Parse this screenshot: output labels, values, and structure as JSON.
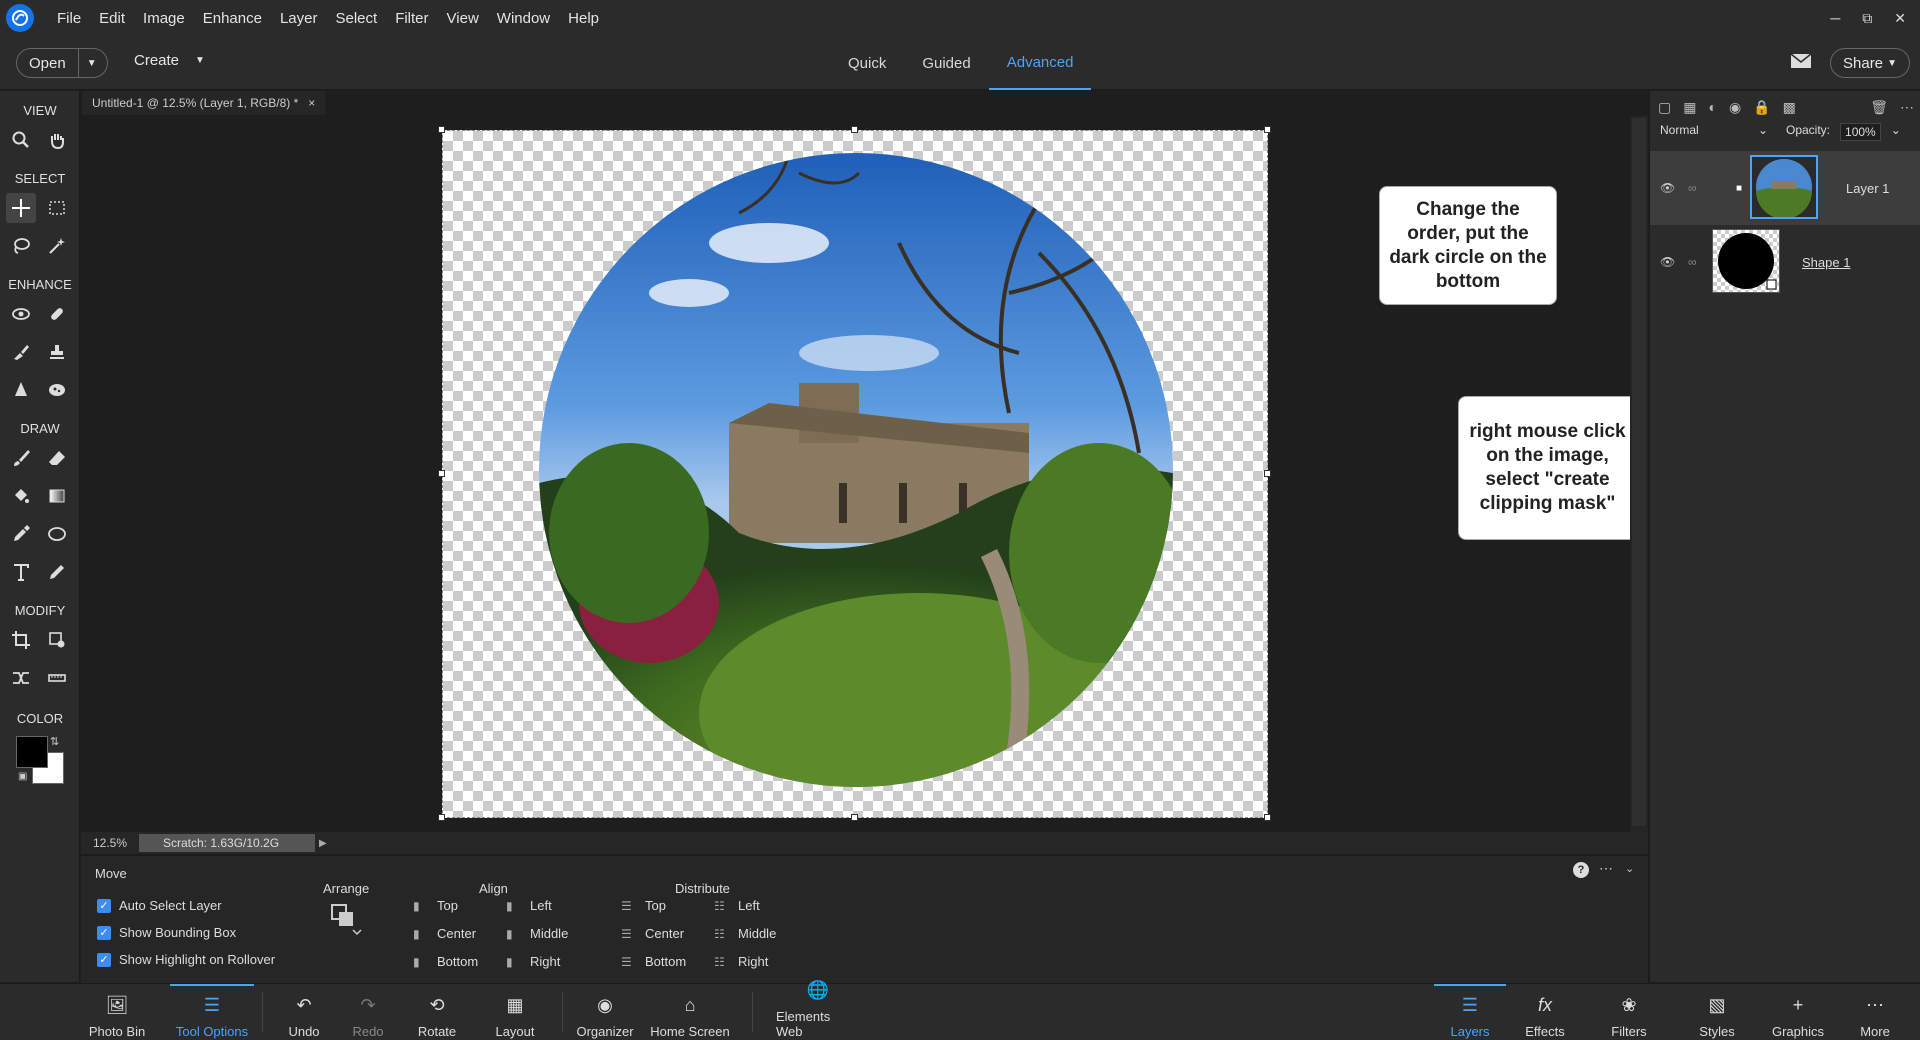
{
  "app": {
    "title": "Adobe Photoshop Elements"
  },
  "menubar": {
    "items": [
      "File",
      "Edit",
      "Image",
      "Enhance",
      "Layer",
      "Select",
      "Filter",
      "View",
      "Window",
      "Help"
    ]
  },
  "topbar": {
    "open_label": "Open",
    "create_label": "Create",
    "modes": [
      "Quick",
      "Guided",
      "Advanced"
    ],
    "active_mode": "Advanced",
    "share_label": "Share"
  },
  "toolbar": {
    "sections": [
      "VIEW",
      "SELECT",
      "ENHANCE",
      "DRAW",
      "MODIFY",
      "COLOR"
    ],
    "foreground_color": "#000000",
    "background_color": "#ffffff"
  },
  "document": {
    "tab_title": "Untitled-1 @ 12.5% (Layer 1, RGB/8) *",
    "close_glyph": "×"
  },
  "annotations": [
    "Change the order, put the dark circle on the bottom",
    "right mouse click on the image, select \"create clipping mask\""
  ],
  "status": {
    "zoom": "12.5%",
    "scratch": "Scratch: 1.63G/10.2G"
  },
  "tool_options": {
    "title": "Move",
    "checkboxes": [
      "Auto Select Layer",
      "Show Bounding Box",
      "Show Highlight on Rollover"
    ],
    "arrange_label": "Arrange",
    "align_label": "Align",
    "distribute_label": "Distribute",
    "align_vertical": [
      "Top",
      "Center",
      "Bottom"
    ],
    "align_horizontal": [
      "Left",
      "Middle",
      "Right"
    ],
    "distribute_vertical": [
      "Top",
      "Center",
      "Bottom"
    ],
    "distribute_horizontal": [
      "Left",
      "Middle",
      "Right"
    ]
  },
  "taskbar": {
    "left": [
      "Photo Bin",
      "Tool Options",
      "Undo",
      "Redo",
      "Rotate",
      "Layout",
      "Organizer",
      "Home Screen",
      "Elements Web"
    ],
    "right": [
      "Layers",
      "Effects",
      "Filters",
      "Styles",
      "Graphics",
      "More"
    ],
    "active_left": "Tool Options",
    "active_right": "Layers"
  },
  "layers": {
    "blend_mode": "Normal",
    "opacity_label": "Opacity:",
    "opacity_value": "100%",
    "items": [
      {
        "name": "Layer 1",
        "selected": true
      },
      {
        "name": "Shape 1",
        "selected": false
      }
    ]
  },
  "colors": {
    "accent": "#4aa3ff",
    "panel_bg": "#2b2b2b"
  }
}
